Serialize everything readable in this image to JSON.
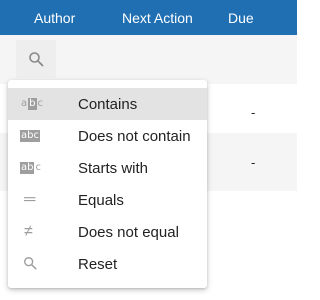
{
  "header": {
    "col_author": "Author",
    "col_next_action": "Next Action",
    "col_due": "Due"
  },
  "rows": [
    {
      "due": "-"
    },
    {
      "due": "-"
    }
  ],
  "filter_menu": {
    "items": [
      {
        "label": "Contains",
        "icon": "contains-icon",
        "active": true
      },
      {
        "label": "Does not contain",
        "icon": "does-not-contain-icon",
        "active": false
      },
      {
        "label": "Starts with",
        "icon": "starts-with-icon",
        "active": false
      },
      {
        "label": "Equals",
        "icon": "equals-icon",
        "active": false
      },
      {
        "label": "Does not equal",
        "icon": "not-equal-icon",
        "active": false
      },
      {
        "label": "Reset",
        "icon": "search-icon",
        "active": false
      }
    ]
  },
  "icon_glyphs": {
    "abc_a": "a",
    "abc_b": "b",
    "abc_c": "c",
    "abc_full": "abc",
    "abc_ab": "ab",
    "equals": "═",
    "not_equal": "≠"
  },
  "colors": {
    "header_bg": "#1f6fb2",
    "active_bg": "#e3e3e3"
  }
}
